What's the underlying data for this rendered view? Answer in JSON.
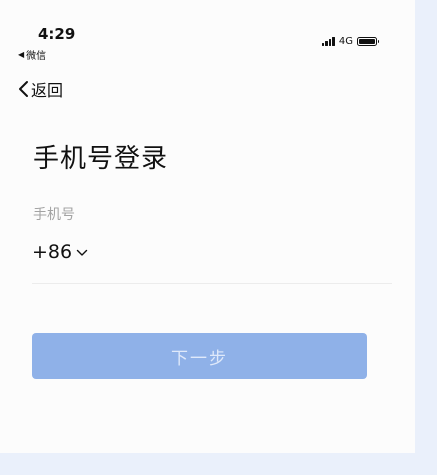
{
  "status_bar": {
    "time": "4:29",
    "back_app": "微信",
    "back_arrow": "◀",
    "network": "4G",
    "signal_icon": "signal-bars-icon",
    "battery_icon": "battery-icon"
  },
  "nav": {
    "back_label": "返回",
    "back_icon": "chevron-left-icon"
  },
  "login": {
    "title": "手机号登录",
    "phone_label": "手机号",
    "country_code": "+86",
    "country_dropdown_icon": "chevron-down-icon",
    "phone_value": "",
    "phone_placeholder": ""
  },
  "actions": {
    "next_label": "下一步"
  },
  "colors": {
    "page_background": "#eaf0fb",
    "screen_background": "#fcfcfc",
    "button_disabled": "#8fb1e8",
    "button_text": "#dfe9fa",
    "muted_text": "#a3a3a3"
  }
}
